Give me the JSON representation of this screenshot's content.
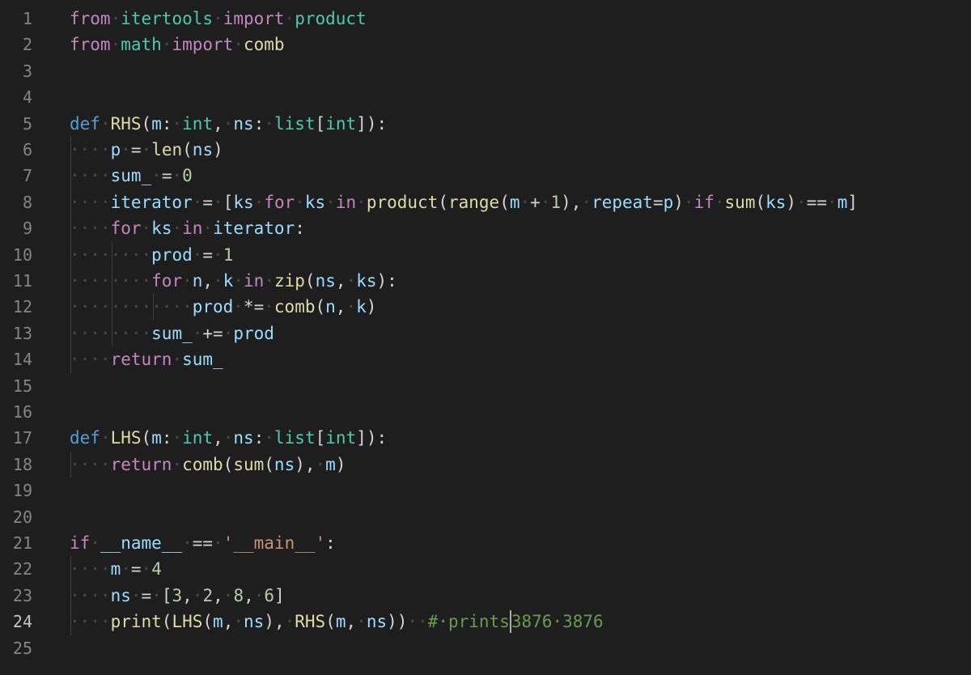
{
  "editor": {
    "language": "python",
    "active_line": 24,
    "colors": {
      "background": "#1e1e1e",
      "keyword_control": "#c586c0",
      "keyword_decl": "#569cd6",
      "module_type": "#4ec9b0",
      "function": "#dcdcaa",
      "variable": "#9cdcfe",
      "number": "#b5cea8",
      "string": "#ce9178",
      "comment": "#6a9955"
    },
    "lines": [
      {
        "n": "1",
        "tokens": [
          [
            "from",
            "kw"
          ],
          [
            "·",
            "ws"
          ],
          [
            "itertools",
            "mod"
          ],
          [
            "·",
            "ws"
          ],
          [
            "import",
            "kw"
          ],
          [
            "·",
            "ws"
          ],
          [
            "product",
            "mod"
          ]
        ]
      },
      {
        "n": "2",
        "tokens": [
          [
            "from",
            "kw"
          ],
          [
            "·",
            "ws"
          ],
          [
            "math",
            "mod"
          ],
          [
            "·",
            "ws"
          ],
          [
            "import",
            "kw"
          ],
          [
            "·",
            "ws"
          ],
          [
            "comb",
            "fn"
          ]
        ]
      },
      {
        "n": "3",
        "tokens": []
      },
      {
        "n": "4",
        "tokens": []
      },
      {
        "n": "5",
        "tokens": [
          [
            "def",
            "kd"
          ],
          [
            "·",
            "ws"
          ],
          [
            "RHS",
            "fn"
          ],
          [
            "(",
            "p"
          ],
          [
            "m",
            "var"
          ],
          [
            ":",
            "p"
          ],
          [
            "·",
            "ws"
          ],
          [
            "int",
            "ty"
          ],
          [
            ",",
            "p"
          ],
          [
            "·",
            "ws"
          ],
          [
            "ns",
            "var"
          ],
          [
            ":",
            "p"
          ],
          [
            "·",
            "ws"
          ],
          [
            "list",
            "ty"
          ],
          [
            "[",
            "p"
          ],
          [
            "int",
            "ty"
          ],
          [
            "]):",
            "p"
          ]
        ]
      },
      {
        "n": "6",
        "tokens": [
          [
            "····",
            "ws"
          ],
          [
            "p",
            "var"
          ],
          [
            "·",
            "ws"
          ],
          [
            "=",
            "op"
          ],
          [
            "·",
            "ws"
          ],
          [
            "len",
            "fn"
          ],
          [
            "(",
            "p"
          ],
          [
            "ns",
            "var"
          ],
          [
            ")",
            "p"
          ]
        ]
      },
      {
        "n": "7",
        "tokens": [
          [
            "····",
            "ws"
          ],
          [
            "sum_",
            "var"
          ],
          [
            "·",
            "ws"
          ],
          [
            "=",
            "op"
          ],
          [
            "·",
            "ws"
          ],
          [
            "0",
            "num"
          ]
        ]
      },
      {
        "n": "8",
        "tokens": [
          [
            "····",
            "ws"
          ],
          [
            "iterator",
            "var"
          ],
          [
            "·",
            "ws"
          ],
          [
            "=",
            "op"
          ],
          [
            "·",
            "ws"
          ],
          [
            "[",
            "p"
          ],
          [
            "ks",
            "var"
          ],
          [
            "·",
            "ws"
          ],
          [
            "for",
            "kw"
          ],
          [
            "·",
            "ws"
          ],
          [
            "ks",
            "var"
          ],
          [
            "·",
            "ws"
          ],
          [
            "in",
            "kw"
          ],
          [
            "·",
            "ws"
          ],
          [
            "product",
            "fn"
          ],
          [
            "(",
            "p"
          ],
          [
            "range",
            "fn"
          ],
          [
            "(",
            "p"
          ],
          [
            "m",
            "var"
          ],
          [
            "·",
            "ws"
          ],
          [
            "+",
            "op"
          ],
          [
            "·",
            "ws"
          ],
          [
            "1",
            "num"
          ],
          [
            "),",
            "p"
          ],
          [
            "·",
            "ws"
          ],
          [
            "repeat",
            "var"
          ],
          [
            "=",
            "op"
          ],
          [
            "p",
            "var"
          ],
          [
            ")",
            "p"
          ],
          [
            "·",
            "ws"
          ],
          [
            "if",
            "kw"
          ],
          [
            "·",
            "ws"
          ],
          [
            "sum",
            "fn"
          ],
          [
            "(",
            "p"
          ],
          [
            "ks",
            "var"
          ],
          [
            ")",
            "p"
          ],
          [
            "·",
            "ws"
          ],
          [
            "==",
            "op"
          ],
          [
            "·",
            "ws"
          ],
          [
            "m",
            "var"
          ],
          [
            "]",
            "p"
          ]
        ]
      },
      {
        "n": "9",
        "tokens": [
          [
            "····",
            "ws"
          ],
          [
            "for",
            "kw"
          ],
          [
            "·",
            "ws"
          ],
          [
            "ks",
            "var"
          ],
          [
            "·",
            "ws"
          ],
          [
            "in",
            "kw"
          ],
          [
            "·",
            "ws"
          ],
          [
            "iterator",
            "var"
          ],
          [
            ":",
            "p"
          ]
        ]
      },
      {
        "n": "10",
        "tokens": [
          [
            "········",
            "ws"
          ],
          [
            "prod",
            "var"
          ],
          [
            "·",
            "ws"
          ],
          [
            "=",
            "op"
          ],
          [
            "·",
            "ws"
          ],
          [
            "1",
            "num"
          ]
        ]
      },
      {
        "n": "11",
        "tokens": [
          [
            "········",
            "ws"
          ],
          [
            "for",
            "kw"
          ],
          [
            "·",
            "ws"
          ],
          [
            "n",
            "var"
          ],
          [
            ",",
            "p"
          ],
          [
            "·",
            "ws"
          ],
          [
            "k",
            "var"
          ],
          [
            "·",
            "ws"
          ],
          [
            "in",
            "kw"
          ],
          [
            "·",
            "ws"
          ],
          [
            "zip",
            "fn"
          ],
          [
            "(",
            "p"
          ],
          [
            "ns",
            "var"
          ],
          [
            ",",
            "p"
          ],
          [
            "·",
            "ws"
          ],
          [
            "ks",
            "var"
          ],
          [
            "):",
            "p"
          ]
        ]
      },
      {
        "n": "12",
        "tokens": [
          [
            "············",
            "ws"
          ],
          [
            "prod",
            "var"
          ],
          [
            "·",
            "ws"
          ],
          [
            "*=",
            "op"
          ],
          [
            "·",
            "ws"
          ],
          [
            "comb",
            "fn"
          ],
          [
            "(",
            "p"
          ],
          [
            "n",
            "var"
          ],
          [
            ",",
            "p"
          ],
          [
            "·",
            "ws"
          ],
          [
            "k",
            "var"
          ],
          [
            ")",
            "p"
          ]
        ]
      },
      {
        "n": "13",
        "tokens": [
          [
            "········",
            "ws"
          ],
          [
            "sum_",
            "var"
          ],
          [
            "·",
            "ws"
          ],
          [
            "+=",
            "op"
          ],
          [
            "·",
            "ws"
          ],
          [
            "prod",
            "var"
          ]
        ]
      },
      {
        "n": "14",
        "tokens": [
          [
            "····",
            "ws"
          ],
          [
            "return",
            "kw"
          ],
          [
            "·",
            "ws"
          ],
          [
            "sum_",
            "var"
          ]
        ]
      },
      {
        "n": "15",
        "tokens": []
      },
      {
        "n": "16",
        "tokens": []
      },
      {
        "n": "17",
        "tokens": [
          [
            "def",
            "kd"
          ],
          [
            "·",
            "ws"
          ],
          [
            "LHS",
            "fn"
          ],
          [
            "(",
            "p"
          ],
          [
            "m",
            "var"
          ],
          [
            ":",
            "p"
          ],
          [
            "·",
            "ws"
          ],
          [
            "int",
            "ty"
          ],
          [
            ",",
            "p"
          ],
          [
            "·",
            "ws"
          ],
          [
            "ns",
            "var"
          ],
          [
            ":",
            "p"
          ],
          [
            "·",
            "ws"
          ],
          [
            "list",
            "ty"
          ],
          [
            "[",
            "p"
          ],
          [
            "int",
            "ty"
          ],
          [
            "]):",
            "p"
          ]
        ]
      },
      {
        "n": "18",
        "tokens": [
          [
            "····",
            "ws"
          ],
          [
            "return",
            "kw"
          ],
          [
            "·",
            "ws"
          ],
          [
            "comb",
            "fn"
          ],
          [
            "(",
            "p"
          ],
          [
            "sum",
            "fn"
          ],
          [
            "(",
            "p"
          ],
          [
            "ns",
            "var"
          ],
          [
            "),",
            "p"
          ],
          [
            "·",
            "ws"
          ],
          [
            "m",
            "var"
          ],
          [
            ")",
            "p"
          ]
        ]
      },
      {
        "n": "19",
        "tokens": []
      },
      {
        "n": "20",
        "tokens": []
      },
      {
        "n": "21",
        "tokens": [
          [
            "if",
            "kw"
          ],
          [
            "·",
            "ws"
          ],
          [
            "__name__",
            "var"
          ],
          [
            "·",
            "ws"
          ],
          [
            "==",
            "op"
          ],
          [
            "·",
            "ws"
          ],
          [
            "'__main__'",
            "str"
          ],
          [
            ":",
            "p"
          ]
        ]
      },
      {
        "n": "22",
        "tokens": [
          [
            "····",
            "ws"
          ],
          [
            "m",
            "var"
          ],
          [
            "·",
            "ws"
          ],
          [
            "=",
            "op"
          ],
          [
            "·",
            "ws"
          ],
          [
            "4",
            "num"
          ]
        ]
      },
      {
        "n": "23",
        "tokens": [
          [
            "····",
            "ws"
          ],
          [
            "ns",
            "var"
          ],
          [
            "·",
            "ws"
          ],
          [
            "=",
            "op"
          ],
          [
            "·",
            "ws"
          ],
          [
            "[",
            "p"
          ],
          [
            "3",
            "num"
          ],
          [
            ",",
            "p"
          ],
          [
            "·",
            "ws"
          ],
          [
            "2",
            "num"
          ],
          [
            ",",
            "p"
          ],
          [
            "·",
            "ws"
          ],
          [
            "8",
            "num"
          ],
          [
            ",",
            "p"
          ],
          [
            "·",
            "ws"
          ],
          [
            "6",
            "num"
          ],
          [
            "]",
            "p"
          ]
        ]
      },
      {
        "n": "24",
        "tokens": [
          [
            "····",
            "ws"
          ],
          [
            "print",
            "fn"
          ],
          [
            "(",
            "p"
          ],
          [
            "LHS",
            "fn"
          ],
          [
            "(",
            "p"
          ],
          [
            "m",
            "var"
          ],
          [
            ",",
            "p"
          ],
          [
            "·",
            "ws"
          ],
          [
            "ns",
            "var"
          ],
          [
            "),",
            "p"
          ],
          [
            "·",
            "ws"
          ],
          [
            "RHS",
            "fn"
          ],
          [
            "(",
            "p"
          ],
          [
            "m",
            "var"
          ],
          [
            ",",
            "p"
          ],
          [
            "·",
            "ws"
          ],
          [
            "ns",
            "var"
          ],
          [
            "))",
            "p"
          ],
          [
            "··",
            "ws"
          ],
          [
            "#·prints",
            "cm"
          ],
          [
            "|",
            "cursor"
          ],
          [
            "3876·3876",
            "cm"
          ]
        ]
      },
      {
        "n": "25",
        "tokens": []
      }
    ]
  }
}
